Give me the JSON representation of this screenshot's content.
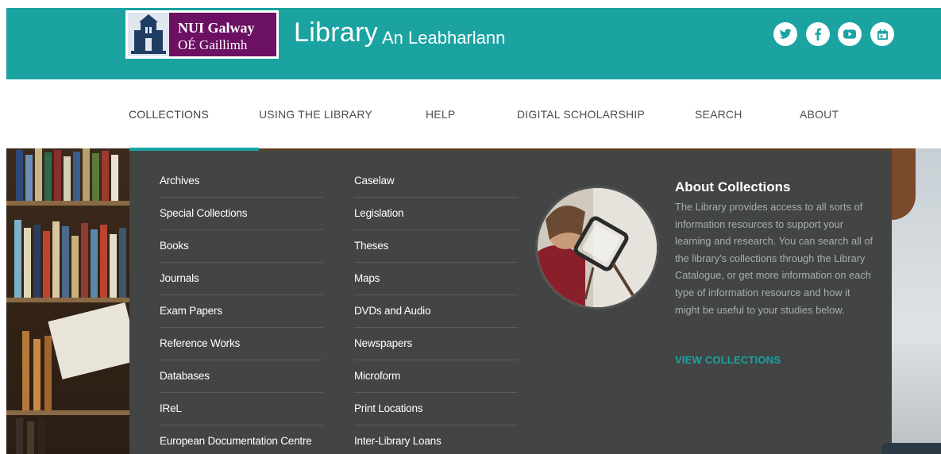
{
  "brand": {
    "logo_name": "NUI Galway",
    "logo_irish": "OÉ Gaillimh",
    "title": "Library",
    "subtitle": "An Leabharlann"
  },
  "social": [
    {
      "icon": "twitter-icon"
    },
    {
      "icon": "facebook-icon"
    },
    {
      "icon": "youtube-icon"
    },
    {
      "icon": "calendar-icon"
    }
  ],
  "nav": {
    "items": [
      {
        "label": "COLLECTIONS",
        "active": true
      },
      {
        "label": "USING THE LIBRARY"
      },
      {
        "label": "HELP"
      },
      {
        "label": "DIGITAL SCHOLARSHIP"
      },
      {
        "label": "SEARCH"
      },
      {
        "label": "ABOUT"
      }
    ]
  },
  "dropdown": {
    "col1": [
      "Archives",
      "Special Collections",
      "Books",
      "Journals",
      "Exam Papers",
      "Reference Works",
      "Databases",
      "IReL",
      "European Documentation Centre"
    ],
    "col2": [
      "Caselaw",
      "Legislation",
      "Theses",
      "Maps",
      "DVDs and Audio",
      "Newspapers",
      "Microform",
      "Print Locations",
      "Inter-Library Loans"
    ],
    "about": {
      "title": "About Collections",
      "body": "The Library provides access to all sorts of information resources to support your learning and research. You can search all of the library's collections through the Library Catalogue, or get more information on each type of information resource and how it might be useful to your studies below.",
      "link": "VIEW COLLECTIONS"
    }
  },
  "colors": {
    "accent": "#1aa3a1",
    "brand_purple": "#6b1062",
    "dropdown_bg": "#434545"
  }
}
